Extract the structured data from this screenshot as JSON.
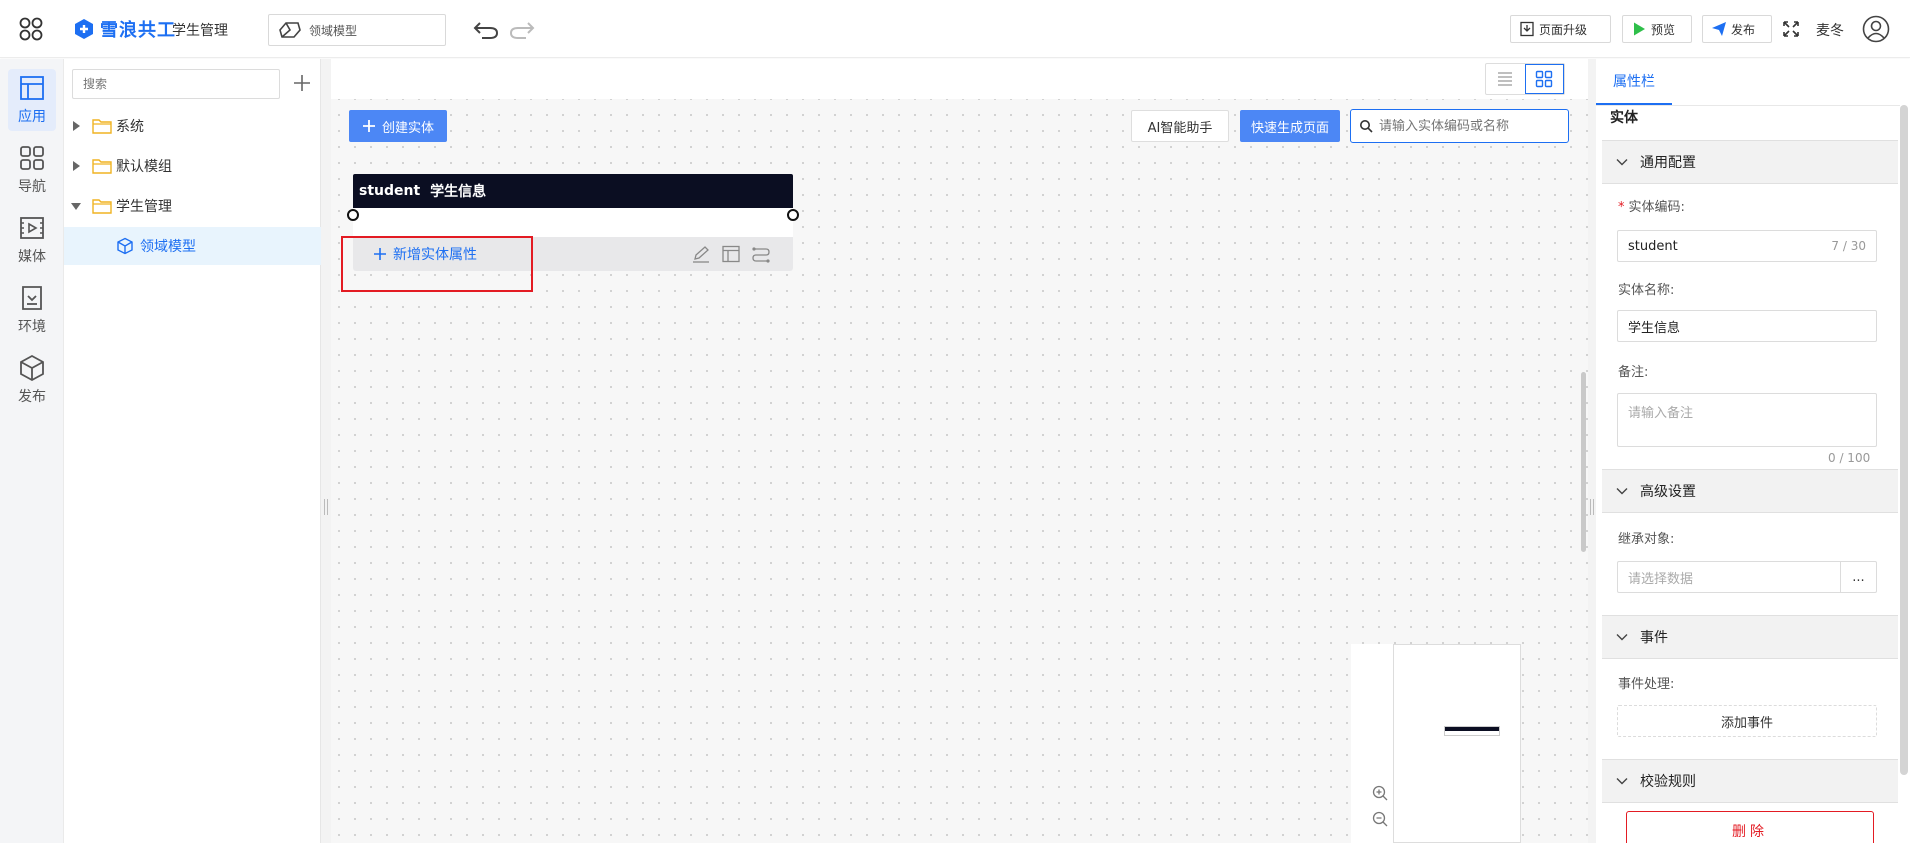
{
  "header": {
    "logo_text": "雪浪共工",
    "app_name": "学生管理",
    "model_select": "领域模型",
    "btn_upgrade": "页面升级",
    "btn_preview": "预览",
    "btn_publish": "发布",
    "username": "麦冬"
  },
  "leftnav": {
    "items": [
      {
        "label": "应用",
        "icon": "app-layout-icon"
      },
      {
        "label": "导航",
        "icon": "grid-icon"
      },
      {
        "label": "媒体",
        "icon": "media-icon"
      },
      {
        "label": "环境",
        "icon": "environment-icon"
      },
      {
        "label": "发布",
        "icon": "cube-icon"
      }
    ]
  },
  "tree": {
    "search_placeholder": "搜索",
    "items": [
      {
        "label": "系统",
        "expanded": false
      },
      {
        "label": "默认模组",
        "expanded": false
      },
      {
        "label": "学生管理",
        "expanded": true
      },
      {
        "label": "领域模型",
        "selected": true
      }
    ]
  },
  "canvas": {
    "btn_create": "创建实体",
    "btn_ai": "AI智能助手",
    "btn_quick": "快速生成页面",
    "search_placeholder": "请输入实体编码或名称",
    "entity": {
      "code": "student",
      "name": "学生信息",
      "add_attr": "新增实体属性"
    }
  },
  "props": {
    "tab": "属性栏",
    "title": "实体",
    "sections": {
      "general": "通用配置",
      "advanced": "高级设置",
      "events": "事件",
      "validation": "校验规则"
    },
    "code_label": "实体编码:",
    "code_value": "student",
    "code_count": "7 / 30",
    "name_label": "实体名称:",
    "name_value": "学生信息",
    "remark_label": "备注:",
    "remark_placeholder": "请输入备注",
    "remark_count": "0 / 100",
    "inherit_label": "继承对象:",
    "inherit_placeholder": "请选择数据",
    "inherit_btn": "...",
    "event_label": "事件处理:",
    "event_btn": "添加事件",
    "delete_btn": "删除"
  },
  "colors": {
    "primary": "#1d6ff2",
    "button_blue": "#4c87f5",
    "entity_header": "#0b0e22",
    "highlight_red": "#e31b23"
  }
}
